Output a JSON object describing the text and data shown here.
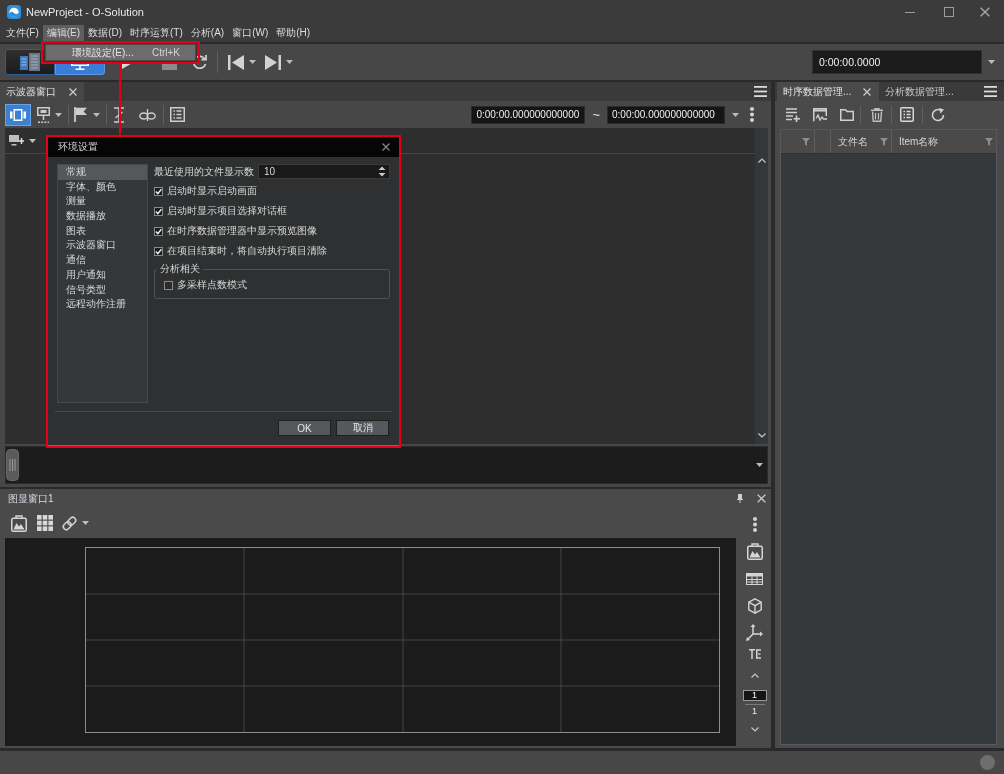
{
  "window": {
    "title": "NewProject - O-Solution"
  },
  "menu_bar": [
    {
      "label": "文件(F)",
      "selected": false
    },
    {
      "label": "编辑(E)",
      "selected": true
    },
    {
      "label": "数据(D)",
      "selected": false
    },
    {
      "label": "时序运算(T)",
      "selected": false
    },
    {
      "label": "分析(A)",
      "selected": false
    },
    {
      "label": "窗口(W)",
      "selected": false
    },
    {
      "label": "帮助(H)",
      "selected": false
    }
  ],
  "edit_menu": [
    {
      "label": "環境設定(E)...",
      "shortcut": "Ctrl+K",
      "highlighted": true
    }
  ],
  "toolbar": {
    "view_modes": [
      {
        "selected": false
      },
      {
        "selected": true
      }
    ],
    "time": "0:00:00.0000"
  },
  "oscilloscope_panel": {
    "tabs": [
      {
        "label": "示波器窗口",
        "selected": true
      }
    ],
    "mode_button": {
      "selected": true
    },
    "range_start": "0:00:00.000000000000",
    "range_separator": "~",
    "range_end": "0:00:00.000000000000"
  },
  "graph_panel": {
    "title": "图显窗口1",
    "page_current": "1",
    "page_total": "1"
  },
  "data_panel": {
    "tabs": [
      {
        "label": "时序数据管理...",
        "selected": true
      },
      {
        "label": "分析数据管理...",
        "selected": false
      }
    ],
    "table": {
      "columns": [
        "文件名",
        "Item名称"
      ]
    }
  },
  "settings_dialog": {
    "title": "环境设置",
    "categories": [
      {
        "label": "常规",
        "selected": true
      },
      {
        "label": "字体、颜色",
        "selected": false
      },
      {
        "label": "测量",
        "selected": false
      },
      {
        "label": "数据播放",
        "selected": false
      },
      {
        "label": "图表",
        "selected": false
      },
      {
        "label": "示波器窗口",
        "selected": false
      },
      {
        "label": "通信",
        "selected": false
      },
      {
        "label": "用户通知",
        "selected": false
      },
      {
        "label": "信号类型",
        "selected": false
      },
      {
        "label": "远程动作注册",
        "selected": false
      }
    ],
    "recent_files": {
      "label": "最近使用的文件显示数",
      "value": "10"
    },
    "options": [
      {
        "label": "启动时显示启动画面",
        "checked": true
      },
      {
        "label": "启动时显示项目选择对话框",
        "checked": true
      },
      {
        "label": "在时序数据管理器中显示预览图像",
        "checked": true
      },
      {
        "label": "在项目结束时，将自动执行项目清除",
        "checked": true
      }
    ],
    "analysis_group": {
      "title": "分析相关",
      "options": [
        {
          "label": "多采样点数模式",
          "checked": false
        }
      ]
    },
    "buttons": [
      "OK",
      "取消"
    ]
  }
}
